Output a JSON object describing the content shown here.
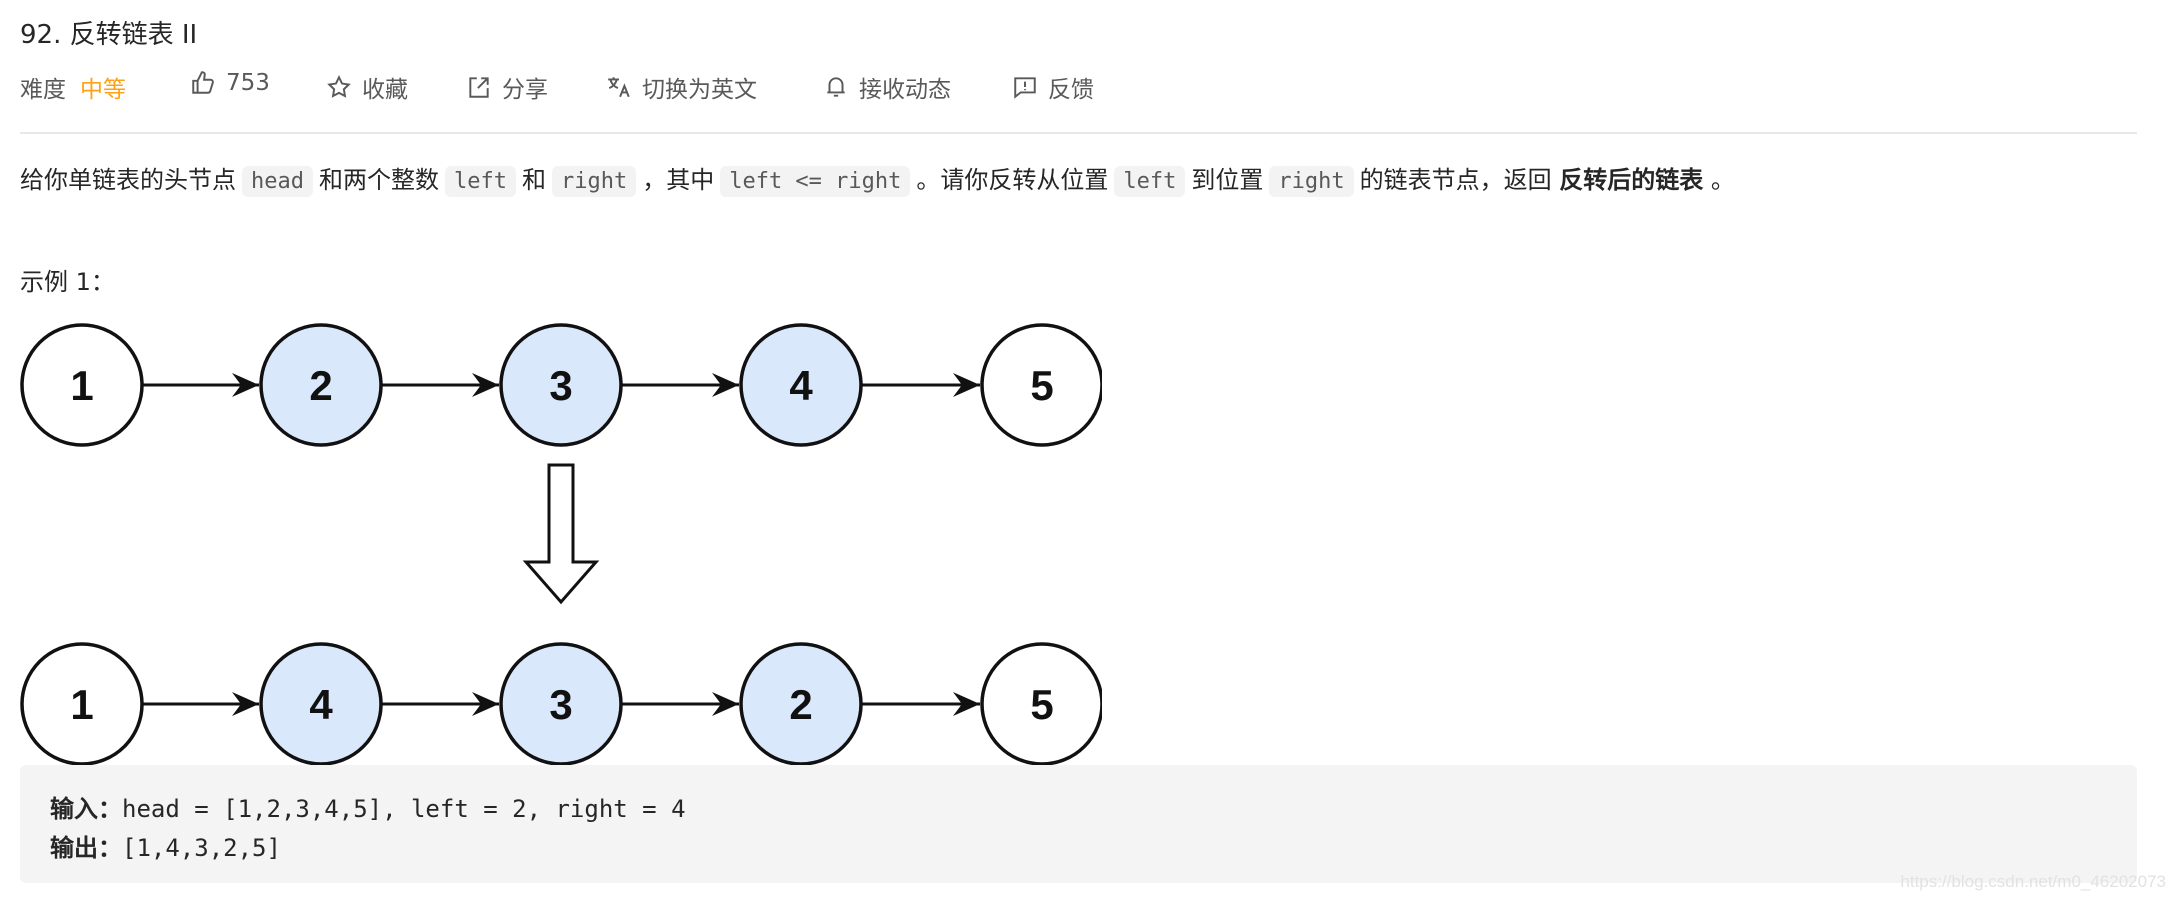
{
  "title": "92. 反转链表 II",
  "meta": {
    "difficulty_label": "难度",
    "difficulty_value": "中等",
    "difficulty_color": "#ffa116",
    "likes": "753",
    "favorite": "收藏",
    "share": "分享",
    "translate": "切换为英文",
    "subscribe": "接收动态",
    "feedback": "反馈"
  },
  "description": {
    "p1": "给你单链表的头节点",
    "c1": "head",
    "p2": "和两个整数",
    "c2": "left",
    "p3": "和",
    "c3": "right",
    "p4": "，其中",
    "c4": "left <= right",
    "p5": "。请你反转从位置",
    "c5": "left",
    "p6": "到位置",
    "c6": "right",
    "p7": "的链表节点，返回",
    "bold": "反转后的链表",
    "p8": "。"
  },
  "example": {
    "title": "示例 1：",
    "diagram": {
      "before": [
        "1",
        "2",
        "3",
        "4",
        "5"
      ],
      "after": [
        "1",
        "4",
        "3",
        "2",
        "5"
      ],
      "highlighted_positions": [
        2,
        3,
        4
      ],
      "highlight_color": "#dae8fc"
    },
    "input_label": "输入：",
    "input_value": "head = [1,2,3,4,5], left = 2, right = 4",
    "output_label": "输出：",
    "output_value": "[1,4,3,2,5]"
  },
  "watermark": "https://blog.csdn.net/m0_46202073"
}
